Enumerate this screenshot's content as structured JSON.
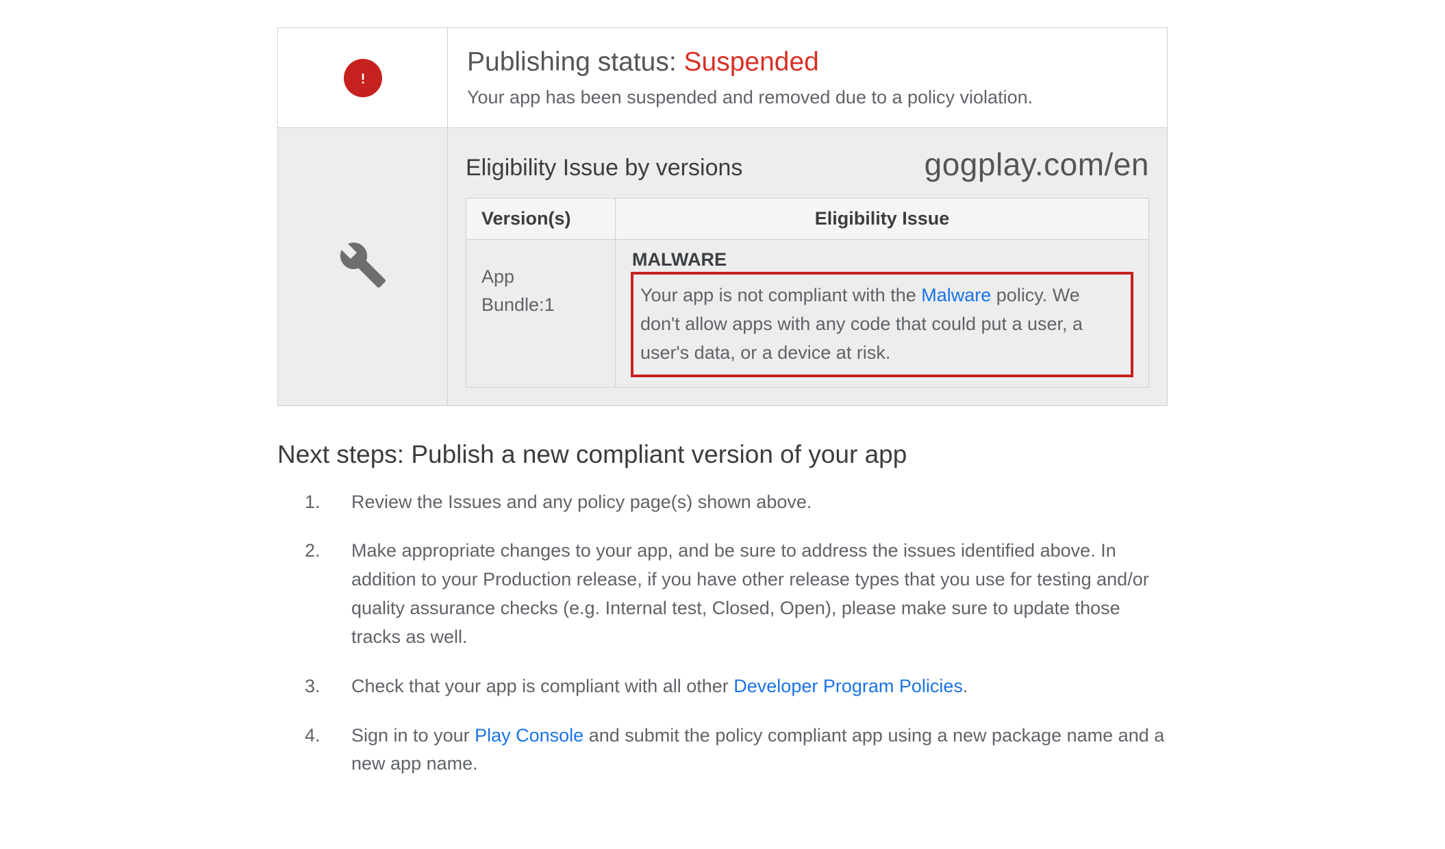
{
  "status": {
    "title_prefix": "Publishing status: ",
    "status_value": "Suspended",
    "description": "Your app has been suspended and removed due to a policy violation."
  },
  "eligibility": {
    "title": "Eligibility Issue by versions",
    "watermark": "gogplay.com/en",
    "table": {
      "header_versions": "Version(s)",
      "header_issue": "Eligibility Issue",
      "row": {
        "version_line1": "App",
        "version_line2": "Bundle:1",
        "issue_heading": "MALWARE",
        "issue_prefix": "Your app is not compliant with the ",
        "issue_link": "Malware",
        "issue_suffix": " policy. We don't allow apps with any code that could put a user, a user's data, or a device at risk."
      }
    }
  },
  "next_steps": {
    "title": "Next steps: Publish a new compliant version of your app",
    "items": {
      "s1": "Review the Issues and any policy page(s) shown above.",
      "s2": "Make appropriate changes to your app, and be sure to address the issues identified above. In addition to your Production release, if you have other release types that you use for testing and/or quality assurance checks (e.g. Internal test, Closed, Open), please make sure to update those tracks as well.",
      "s3_prefix": "Check that your app is compliant with all other ",
      "s3_link": "Developer Program Policies",
      "s3_suffix": ".",
      "s4_prefix": "Sign in to your ",
      "s4_link": "Play Console",
      "s4_suffix": " and submit the policy compliant app using a new package name and a new app name."
    }
  }
}
